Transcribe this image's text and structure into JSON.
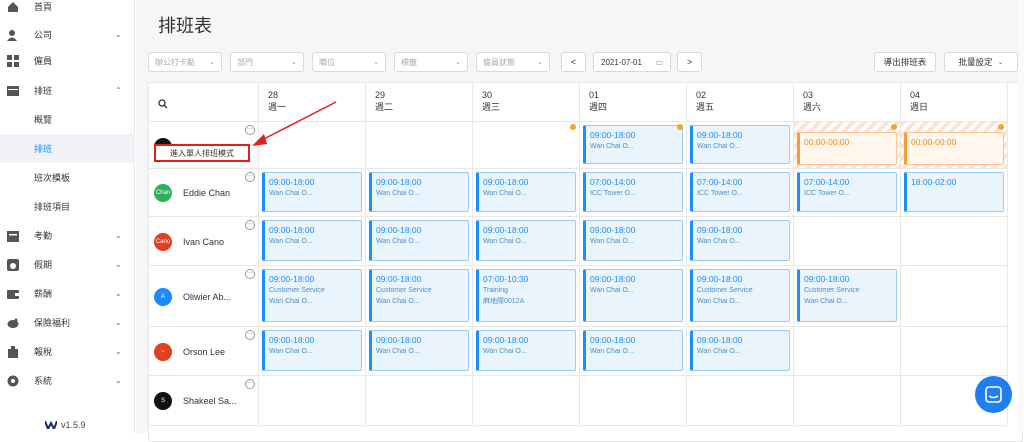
{
  "sidebar": {
    "items": [
      {
        "label": "首頁",
        "icon": "home-icon",
        "chev": ""
      },
      {
        "label": "公司",
        "icon": "company-icon",
        "chev": "⌄"
      },
      {
        "label": "僱員",
        "icon": "employee-icon",
        "chev": ""
      },
      {
        "label": "排班",
        "icon": "schedule-icon",
        "chev": "⌃"
      },
      {
        "label": "概覽",
        "icon": "",
        "chev": ""
      },
      {
        "label": "排班",
        "icon": "",
        "chev": ""
      },
      {
        "label": "班次模板",
        "icon": "",
        "chev": ""
      },
      {
        "label": "排班項目",
        "icon": "",
        "chev": ""
      },
      {
        "label": "考勤",
        "icon": "attendance-icon",
        "chev": "⌄"
      },
      {
        "label": "假期",
        "icon": "leave-icon",
        "chev": "⌄"
      },
      {
        "label": "薪酬",
        "icon": "payroll-icon",
        "chev": "⌄"
      },
      {
        "label": "保險福利",
        "icon": "insurance-icon",
        "chev": "⌄"
      },
      {
        "label": "報稅",
        "icon": "tax-icon",
        "chev": "⌄"
      },
      {
        "label": "系統",
        "icon": "system-icon",
        "chev": "⌄"
      }
    ],
    "version": "v1.5.9"
  },
  "page": {
    "title": "排班表"
  },
  "filters": {
    "office": "辦公打卡點",
    "dept": "部門",
    "position": "職位",
    "tag": "標籤",
    "status": "僱員狀態"
  },
  "date_nav": {
    "prev": "<",
    "date": "2021-07-01",
    "next": ">"
  },
  "actions": {
    "export": "導出排班表",
    "bulk": "批量設定"
  },
  "days": [
    {
      "num": "28",
      "name": "週一"
    },
    {
      "num": "29",
      "name": "週二"
    },
    {
      "num": "30",
      "name": "週三"
    },
    {
      "num": "01",
      "name": "週四"
    },
    {
      "num": "02",
      "name": "週五"
    },
    {
      "num": "03",
      "name": "週六"
    },
    {
      "num": "04",
      "name": "週日"
    }
  ],
  "tooltip": "進入單人排班模式",
  "employees": [
    {
      "name": "",
      "avatar": "",
      "avatar_color": "#111111"
    },
    {
      "name": "Eddie Chan",
      "avatar": "Chan",
      "avatar_color": "#2eaf5b"
    },
    {
      "name": "Ivan Cano",
      "avatar": "Cano",
      "avatar_color": "#e2401f"
    },
    {
      "name": "Oliwier Ab...",
      "avatar": "A",
      "avatar_color": "#1a8cff"
    },
    {
      "name": "Orson Lee",
      "avatar": "~",
      "avatar_color": "#e2401f"
    },
    {
      "name": "Shakeel Sa...",
      "avatar": "S",
      "avatar_color": "#111111"
    }
  ],
  "shifts": [
    [
      null,
      null,
      null,
      {
        "time": "09:00-18:00",
        "loc": "Wan Chai O..."
      },
      {
        "time": "09:00-18:00",
        "loc": "Wan Chai O..."
      },
      {
        "time": "00:00-00:00",
        "loc": "",
        "orange": true
      },
      {
        "time": "00:00-00:00",
        "loc": "",
        "orange": true
      }
    ],
    [
      {
        "time": "09:00-18:00",
        "loc": "Wan Chai O..."
      },
      {
        "time": "09:00-18:00",
        "loc": "Wan Chai O..."
      },
      {
        "time": "09:00-18:00",
        "loc": "Wan Chai O..."
      },
      {
        "time": "07:00-14:00",
        "loc": "ICC Tower O..."
      },
      {
        "time": "07:00-14:00",
        "loc": "ICC Tower O..."
      },
      {
        "time": "07:00-14:00",
        "loc": "ICC Tower O..."
      },
      {
        "time": "18:00-02:00",
        "loc": ""
      }
    ],
    [
      {
        "time": "09:00-18:00",
        "loc": "Wan Chai O..."
      },
      {
        "time": "09:00-18:00",
        "loc": "Wan Chai O..."
      },
      {
        "time": "09:00-18:00",
        "loc": "Wan Chai O..."
      },
      {
        "time": "09:00-18:00",
        "loc": "Wan Chai O..."
      },
      {
        "time": "09:00-18:00",
        "loc": "Wan Chai O..."
      },
      null,
      null
    ],
    [
      {
        "time": "09:00-18:00",
        "sub": "Customer Service",
        "loc": "Wan Chai O..."
      },
      {
        "time": "09:00-18:00",
        "sub": "Customer Service",
        "loc": "Wan Chai O..."
      },
      {
        "time": "07:00-10:30",
        "sub": "Training",
        "loc": "麻地際0012A"
      },
      {
        "time": "09:00-18:00",
        "loc": "Wan Chai O..."
      },
      {
        "time": "09:00-18:00",
        "sub": "Customer Service",
        "loc": "Wan Chai O..."
      },
      {
        "time": "09:00-18:00",
        "sub": "Customer Service",
        "loc": "Wan Chai O..."
      },
      null
    ],
    [
      {
        "time": "09:00-18:00",
        "loc": "Wan Chai O..."
      },
      {
        "time": "09:00-18:00",
        "loc": "Wan Chai O..."
      },
      {
        "time": "09:00-18:00",
        "loc": "Wan Chai O..."
      },
      {
        "time": "09:00-18:00",
        "loc": "Wan Chai O..."
      },
      {
        "time": "09:00-18:00",
        "loc": "Wan Chai O..."
      },
      null,
      null
    ],
    [
      null,
      null,
      null,
      null,
      null,
      null,
      null
    ]
  ]
}
